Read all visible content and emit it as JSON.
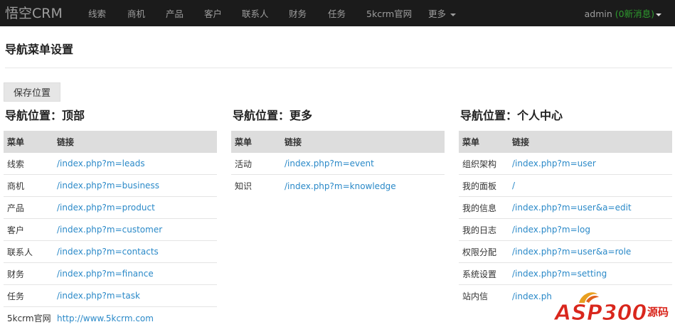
{
  "navbar": {
    "brand": "悟空CRM",
    "items": [
      "线索",
      "商机",
      "产品",
      "客户",
      "联系人",
      "财务",
      "任务",
      "5kcrm官网"
    ],
    "more": "更多",
    "user": "admin",
    "messages": "(0新消息)"
  },
  "page": {
    "title": "导航菜单设置",
    "save_label": "保存位置"
  },
  "table_headers": {
    "menu": "菜单",
    "link": "链接"
  },
  "sections": [
    {
      "title": "导航位置：顶部",
      "rows": [
        {
          "menu": "线索",
          "link": "/index.php?m=leads"
        },
        {
          "menu": "商机",
          "link": "/index.php?m=business"
        },
        {
          "menu": "产品",
          "link": "/index.php?m=product"
        },
        {
          "menu": "客户",
          "link": "/index.php?m=customer"
        },
        {
          "menu": "联系人",
          "link": "/index.php?m=contacts"
        },
        {
          "menu": "财务",
          "link": "/index.php?m=finance"
        },
        {
          "menu": "任务",
          "link": "/index.php?m=task"
        },
        {
          "menu": "5kcrm官网",
          "link": "http://www.5kcrm.com"
        }
      ]
    },
    {
      "title": "导航位置：更多",
      "rows": [
        {
          "menu": "活动",
          "link": "/index.php?m=event"
        },
        {
          "menu": "知识",
          "link": "/index.php?m=knowledge"
        }
      ]
    },
    {
      "title": "导航位置：个人中心",
      "rows": [
        {
          "menu": "组织架构",
          "link": "/index.php?m=user"
        },
        {
          "menu": "我的面板",
          "link": "/"
        },
        {
          "menu": "我的信息",
          "link": "/index.php?m=user&a=edit"
        },
        {
          "menu": "我的日志",
          "link": "/index.php?m=log"
        },
        {
          "menu": "权限分配",
          "link": "/index.php?m=user&a=role"
        },
        {
          "menu": "系统设置",
          "link": "/index.php?m=setting"
        },
        {
          "menu": "站内信",
          "link": "/index.ph"
        }
      ]
    }
  ],
  "watermark": {
    "text": "ASP300",
    "sub": "源码"
  },
  "colors": {
    "navbar_bg": "#1b1b1b",
    "link": "#2a89c8",
    "header_bg": "#dddddd",
    "msg_green": "#2e9c2e"
  }
}
